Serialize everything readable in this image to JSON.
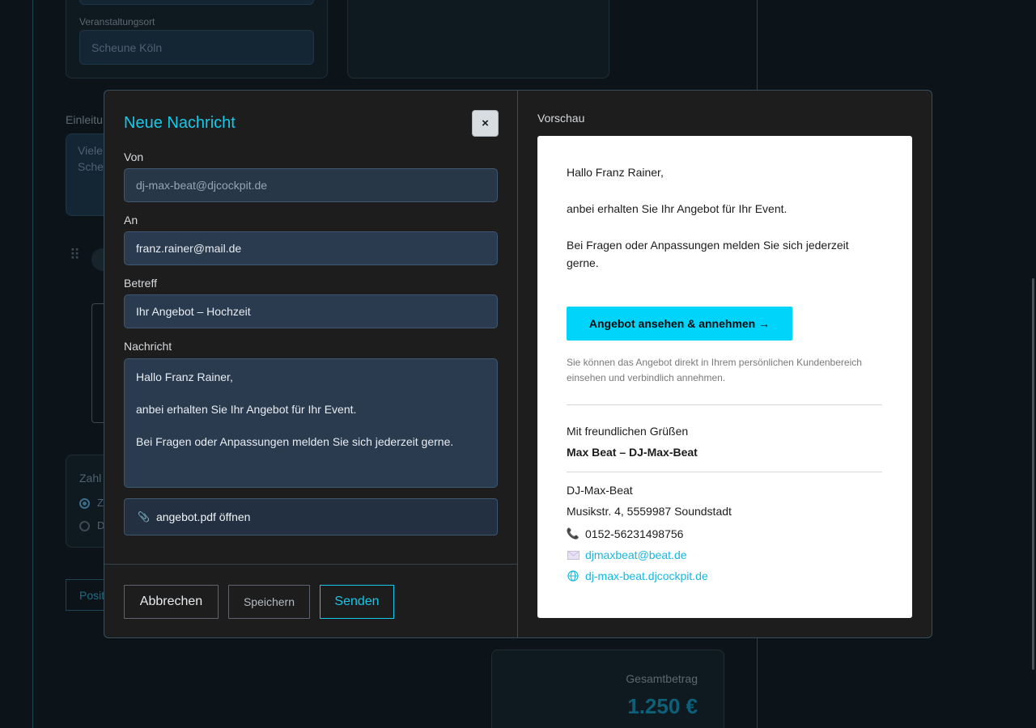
{
  "background": {
    "venue_label": "Veranstaltungsort",
    "venue_value": "Scheune Köln",
    "intro_label_partial": "Einleitu",
    "intro_text_partial_1": "Viele",
    "intro_text_partial_2": "Sche",
    "payment_label_partial": "Zahl",
    "radio_1_partial": "Z",
    "radio_2_partial": "D",
    "positions_button_partial": "Posit",
    "total_label": "Gesamtbetrag",
    "total_value": "1.250 €"
  },
  "modal": {
    "title": "Neue Nachricht",
    "close_label": "×",
    "from_label": "Von",
    "from_value": "dj-max-beat@djcockpit.de",
    "to_label": "An",
    "to_value": "franz.rainer@mail.de",
    "subject_label": "Betreff",
    "subject_value": "Ihr Angebot – Hochzeit",
    "message_label": "Nachricht",
    "message_lines": [
      "Hallo Franz Rainer,",
      "anbei erhalten Sie Ihr Angebot für Ihr Event.",
      "Bei Fragen oder Anpassungen melden Sie sich jederzeit gerne."
    ],
    "attachment_label": "angebot.pdf öffnen",
    "buttons": {
      "cancel": "Abbrechen",
      "save": "Speichern",
      "send": "Senden"
    }
  },
  "preview": {
    "label": "Vorschau",
    "greeting": "Hallo Franz Rainer,",
    "body_1": "anbei erhalten Sie Ihr Angebot für Ihr Event.",
    "body_2": "Bei Fragen oder Anpassungen melden Sie sich jederzeit gerne.",
    "cta": "Angebot ansehen & annehmen →",
    "note": "Sie können das Angebot direkt in Ihrem persönlichen Kundenbereich einsehen und verbindlich annehmen.",
    "closing": "Mit freundlichen Grüßen",
    "signature": "Max Beat – DJ-Max-Beat",
    "company": "DJ-Max-Beat",
    "address": "Musikstr. 4, 5559987 Soundstadt",
    "phone": "0152-56231498756",
    "email": "djmaxbeat@beat.de",
    "website": "dj-max-beat.djcockpit.de"
  },
  "colors": {
    "accent": "#18c8e8",
    "cta": "#00d4fa"
  }
}
